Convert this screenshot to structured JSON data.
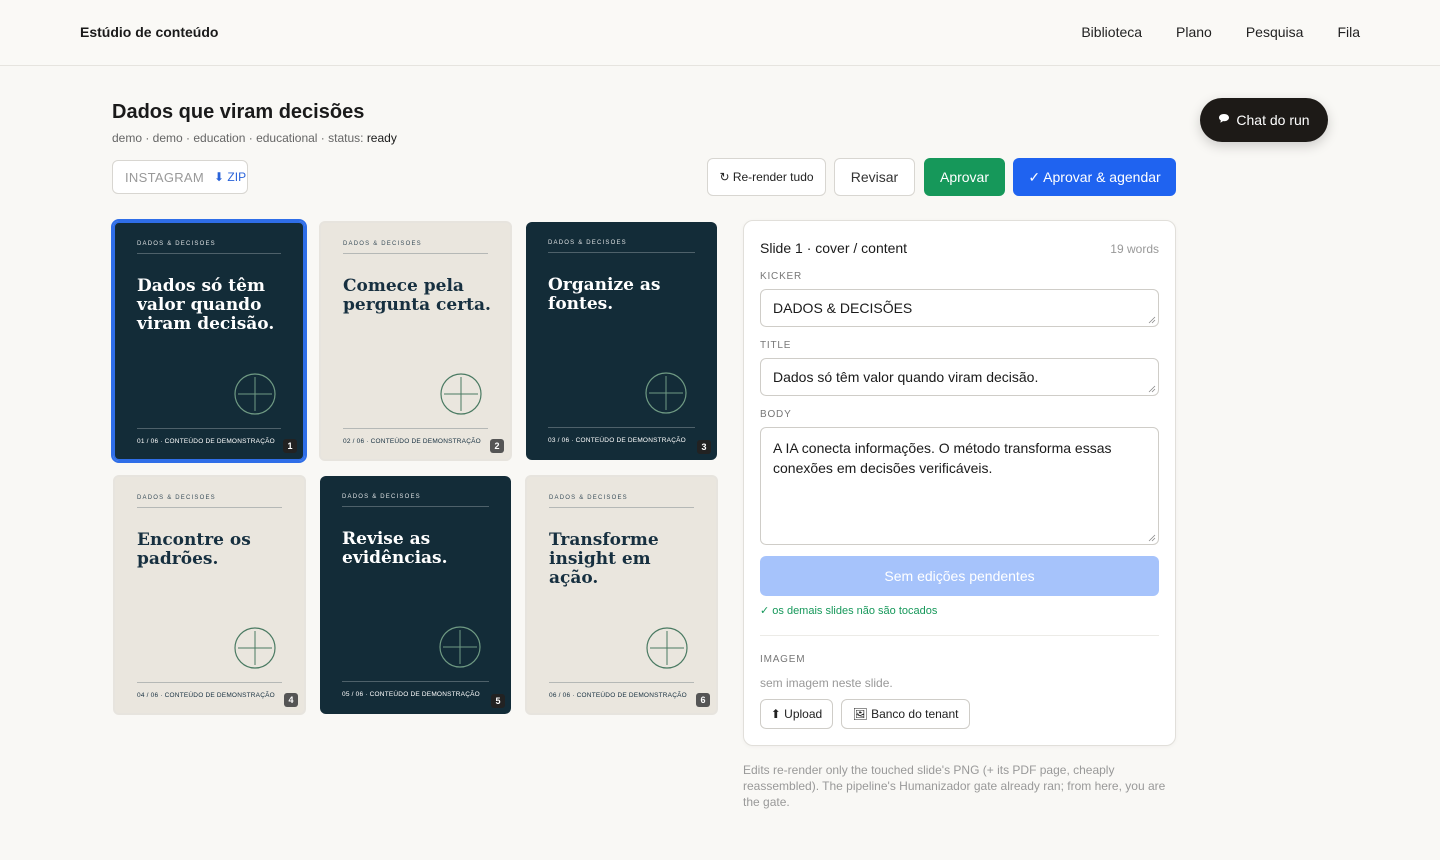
{
  "app": {
    "brand": "Estúdio de conteúdo"
  },
  "nav": {
    "items": [
      "Biblioteca",
      "Plano",
      "Pesquisa",
      "Fila"
    ]
  },
  "chat": {
    "label": "Chat do run",
    "icon": "speech-bubble-icon"
  },
  "run": {
    "title": "Dados que viram decisões",
    "meta_prefix": "demo · demo · education · educational · status: ",
    "status": "ready"
  },
  "format": {
    "label": "INSTAGRAM",
    "zip": "⬇ ZIP"
  },
  "actions": {
    "rerender": "↻ Re-render tudo",
    "revisar": "Revisar",
    "aprovar": "Aprovar",
    "aprovar_agendar": "✓ Aprovar & agendar"
  },
  "colors": {
    "dark_slide": "#132c38",
    "light_slide": "#eae6de",
    "primary": "#1f63f0",
    "success": "#16985a"
  },
  "slides": [
    {
      "kicker": "DADOS & DECISÕES",
      "title": "Dados só têm valor quando viram decisão.",
      "footer": "01 / 06 · CONTEÚDO DE DEMONSTRAÇÃO",
      "number": "1",
      "theme": "dark",
      "selected": true
    },
    {
      "kicker": "DADOS & DECISÕES",
      "title": "Comece pela pergunta certa.",
      "footer": "02 / 06 · CONTEÚDO DE DEMONSTRAÇÃO",
      "number": "2",
      "theme": "light"
    },
    {
      "kicker": "DADOS & DECISÕES",
      "title": "Organize as fontes.",
      "footer": "03 / 06 · CONTEÚDO DE DEMONSTRAÇÃO",
      "number": "3",
      "theme": "dark"
    },
    {
      "kicker": "DADOS & DECISÕES",
      "title": "Encontre os padrões.",
      "footer": "04 / 06 · CONTEÚDO DE DEMONSTRAÇÃO",
      "number": "4",
      "theme": "light"
    },
    {
      "kicker": "DADOS & DECISÕES",
      "title": "Revise as evidências.",
      "footer": "05 / 06 · CONTEÚDO DE DEMONSTRAÇÃO",
      "number": "5",
      "theme": "dark"
    },
    {
      "kicker": "DADOS & DECISÕES",
      "title": "Transforme insight em ação.",
      "footer": "06 / 06 · CONTEÚDO DE DEMONSTRAÇÃO",
      "number": "6",
      "theme": "light"
    }
  ],
  "editor": {
    "heading": "Slide 1 · cover / content",
    "words": "19 words",
    "kicker_label": "KICKER",
    "kicker_value": "DADOS & DECISÕES",
    "title_label": "TITLE",
    "title_value": "Dados só têm valor quando viram decisão.",
    "body_label": "BODY",
    "body_value": "A IA conecta informações. O método transforma essas conexões em decisões verificáveis.",
    "pending": "Sem edições pendentes",
    "untouched": "✓ os demais slides não são tocados",
    "image_label": "IMAGEM",
    "no_image": "sem imagem neste slide.",
    "upload": "⬆ Upload",
    "banco": "🖼 Banco do tenant"
  },
  "note": "Edits re-render only the touched slide's PNG (+ its PDF page, cheaply reassembled). The pipeline's Humanizador gate already ran; from here, you are the gate."
}
